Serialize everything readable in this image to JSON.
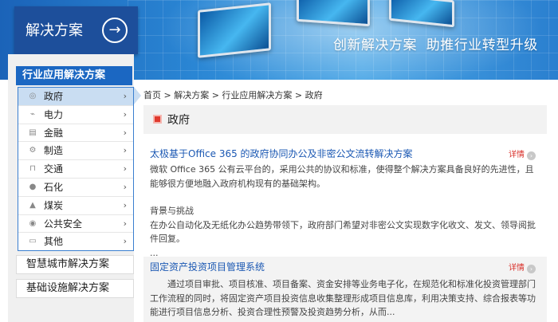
{
  "banner": {
    "title": "解决方案",
    "slogan": "创新解决方案  助推行业转型升级"
  },
  "sidebar": {
    "header": "行业应用解决方案",
    "items": [
      {
        "label": "政府",
        "icon": "building-icon",
        "active": true
      },
      {
        "label": "电力",
        "icon": "power-icon"
      },
      {
        "label": "金融",
        "icon": "finance-icon"
      },
      {
        "label": "制造",
        "icon": "factory-icon"
      },
      {
        "label": "交通",
        "icon": "transport-icon"
      },
      {
        "label": "石化",
        "icon": "petrochemical-icon"
      },
      {
        "label": "煤炭",
        "icon": "coal-icon"
      },
      {
        "label": "公共安全",
        "icon": "police-icon"
      },
      {
        "label": "其他",
        "icon": "other-icon"
      }
    ],
    "links": [
      "智慧城市解决方案",
      "基础设施解决方案"
    ]
  },
  "breadcrumb": "首页 > 解决方案 > 行业应用解决方案 > 政府",
  "section_title": "政府",
  "articles": [
    {
      "title": "太极基于Office 365 的政府协同办公及非密公文流转解决方案",
      "more": "详情",
      "paragraph1": "微软 Office 365 公有云平台的，采用公共的协议和标准，使得整个解决方案具备良好的先进性，且能够很方便地融入政府机构现有的基础架构。",
      "paragraph2": "背景与挑战\n在办公自动化及无纸化办公趋势带领下，政府部门希望对非密公文实现数字化收文、发文、领导阅批件回复。\n..."
    },
    {
      "title": "固定资产投资项目管理系统",
      "more": "详情",
      "paragraph1": "通过项目审批、项目核准、项目备案、资金安排等业务电子化，在规范化和标准化投资管理部门工作流程的同时，将固定资产项目投资信息收集整理形成项目信息库，利用决策支持、综合报表等功能进行项目信息分析、投资合理性预警及投资趋势分析，从而..."
    }
  ]
}
